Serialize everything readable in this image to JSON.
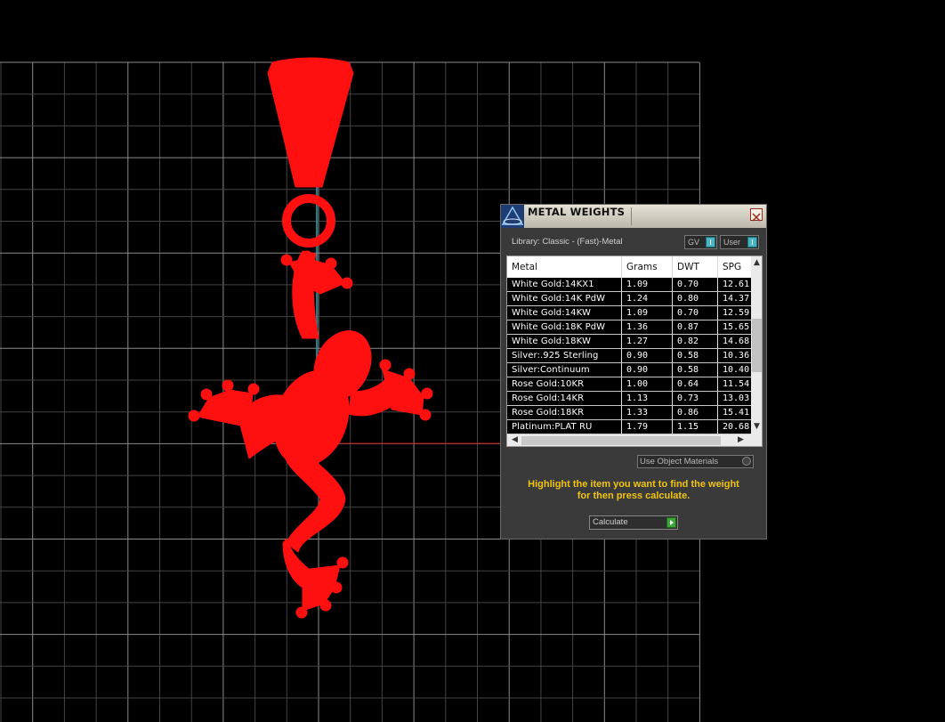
{
  "dialog": {
    "title": "METAL WEIGHTS",
    "library_label": "Library: Classic - (Fast)-Metal",
    "toggle_gv": "GV",
    "toggle_user": "User",
    "use_object_materials": "Use Object Materials",
    "instructions_line1": "Highlight the item you want to find the weight",
    "instructions_line2": "for then press calculate.",
    "calculate_label": "Calculate"
  },
  "table": {
    "headers": [
      "Metal",
      "Grams",
      "DWT",
      "SPG"
    ],
    "rows": [
      [
        "White Gold:14KX1",
        "1.09",
        "0.70",
        "12.61"
      ],
      [
        "White Gold:14K PdW",
        "1.24",
        "0.80",
        "14.37"
      ],
      [
        "White Gold:14KW",
        "1.09",
        "0.70",
        "12.59"
      ],
      [
        "White Gold:18K PdW",
        "1.36",
        "0.87",
        "15.65"
      ],
      [
        "White Gold:18KW",
        "1.27",
        "0.82",
        "14.68"
      ],
      [
        "Silver:.925 Sterling",
        "0.90",
        "0.58",
        "10.36"
      ],
      [
        "Silver:Continuum",
        "0.90",
        "0.58",
        "10.40"
      ],
      [
        "Rose Gold:10KR",
        "1.00",
        "0.64",
        "11.54"
      ],
      [
        "Rose Gold:14KR",
        "1.13",
        "0.73",
        "13.03"
      ],
      [
        "Rose Gold:18KR",
        "1.33",
        "0.86",
        "15.41"
      ],
      [
        "Platinum:PLAT RU",
        "1.79",
        "1.15",
        "20.68"
      ]
    ]
  },
  "colors": {
    "model": "#ff1010",
    "grid": "#5a5a5a",
    "instructions": "#f0c40f",
    "axis_cyan": "#2aa7b8",
    "axis_red": "#c01010"
  }
}
